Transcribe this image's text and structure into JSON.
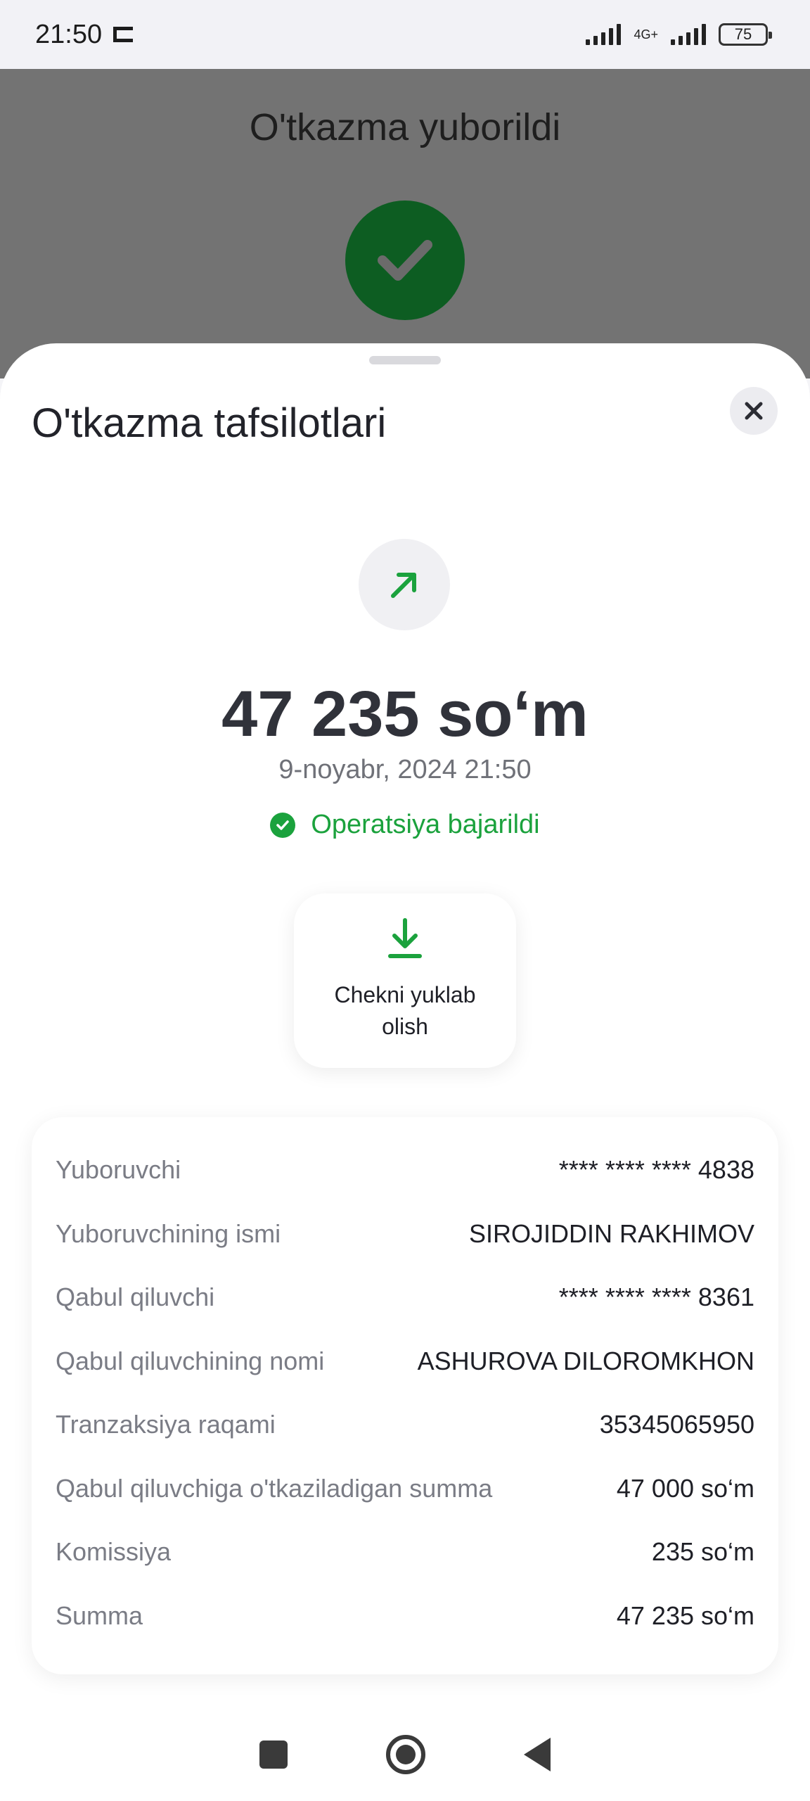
{
  "status_bar": {
    "time": "21:50",
    "network": "4G+",
    "battery": "75"
  },
  "backdrop": {
    "title": "O'tkazma yuborildi"
  },
  "sheet": {
    "title": "O'tkazma tafsilotlari",
    "amount": "47 235 so‘m",
    "datetime": "9-noyabr, 2024 21:50",
    "status": "Operatsiya bajarildi",
    "download_label": "Chekni yuklab olish"
  },
  "details": [
    {
      "label": "Yuboruvchi",
      "value": "**** **** **** 4838"
    },
    {
      "label": "Yuboruvchining ismi",
      "value": "SIROJIDDIN RAKHIMOV"
    },
    {
      "label": "Qabul qiluvchi",
      "value": "**** **** **** 8361"
    },
    {
      "label": "Qabul qiluvchining nomi",
      "value": "ASHUROVA DILOROMKHON"
    },
    {
      "label": "Tranzaksiya raqami",
      "value": "35345065950"
    },
    {
      "label": "Qabul qiluvchiga o'tkaziladigan summa",
      "value": "47 000 so‘m"
    },
    {
      "label": "Komissiya",
      "value": "235 so‘m"
    },
    {
      "label": "Summa",
      "value": "47 235 so‘m"
    }
  ],
  "colors": {
    "success_green": "#1ba23d",
    "dark_green": "#0d5d22",
    "backdrop": "#737373"
  },
  "icons": {
    "status_bar_notification": "screen-record-icon",
    "success": "checkmark-icon",
    "transfer": "arrow-up-right-icon",
    "download": "download-icon",
    "close": "close-icon"
  }
}
